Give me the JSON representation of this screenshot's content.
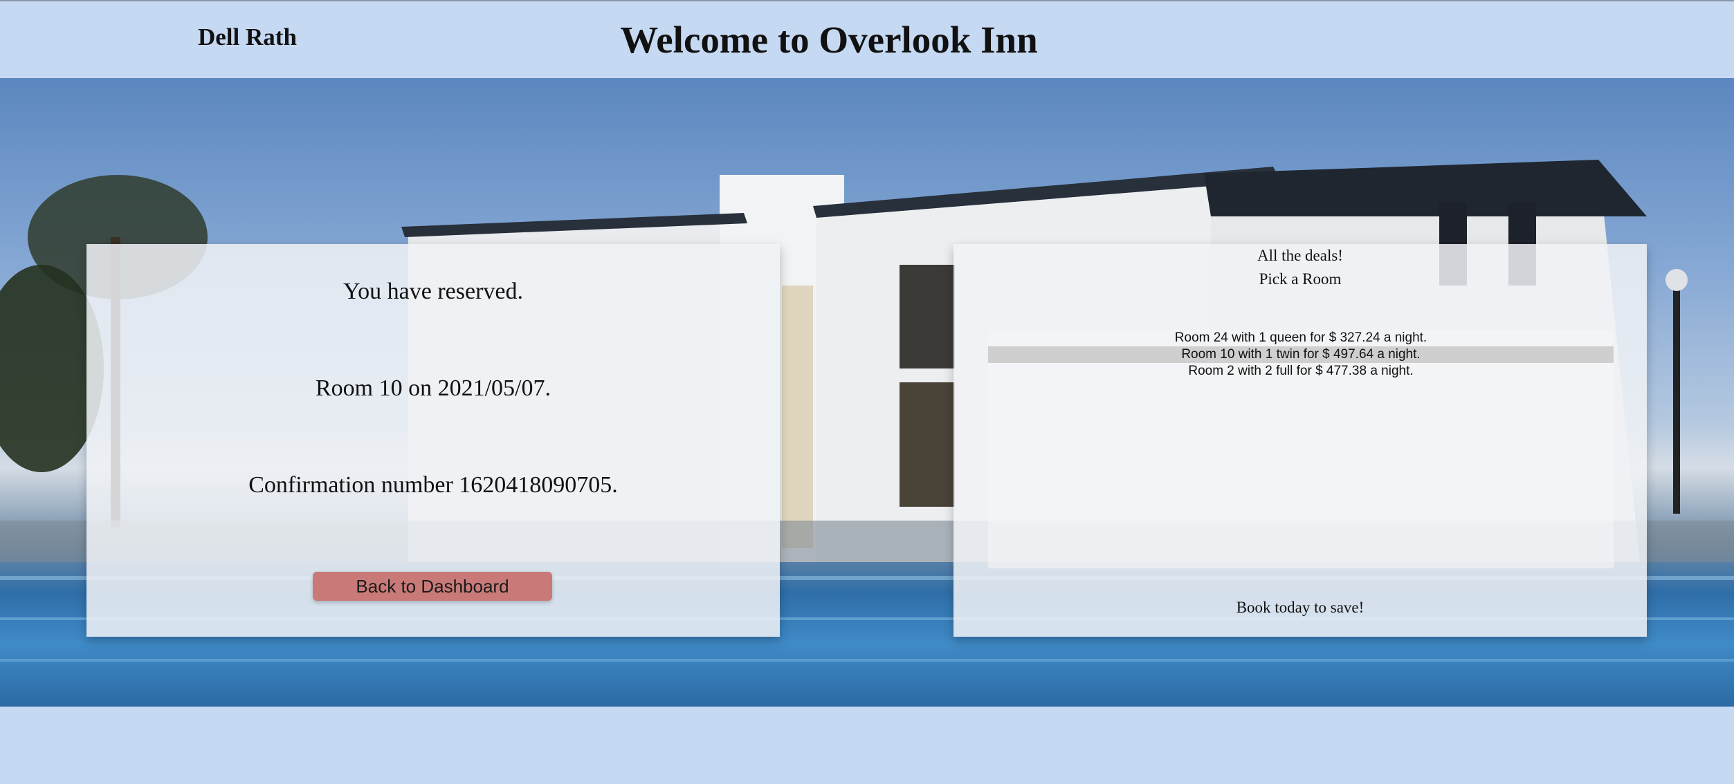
{
  "header": {
    "user_name": "Dell Rath",
    "title": "Welcome to Overlook Inn"
  },
  "reservation": {
    "line1": "You have reserved.",
    "line2": "Room 10 on 2021/05/07.",
    "line3": "Confirmation number 1620418090705.",
    "back_button": "Back to Dashboard"
  },
  "deals": {
    "heading": "All the deals!",
    "subheading": "Pick a Room",
    "rooms": [
      {
        "label": "Room 24 with 1 queen for $ 327.24 a night.",
        "selected": false
      },
      {
        "label": "Room 10 with 1 twin for $ 497.64 a night.",
        "selected": true
      },
      {
        "label": "Room 2 with 2 full for $ 477.38 a night.",
        "selected": false
      }
    ],
    "footer": "Book today to save!"
  },
  "colors": {
    "background": "#c6d9f3",
    "button": "#c97a78",
    "selected_row": "#cfcfcf"
  }
}
